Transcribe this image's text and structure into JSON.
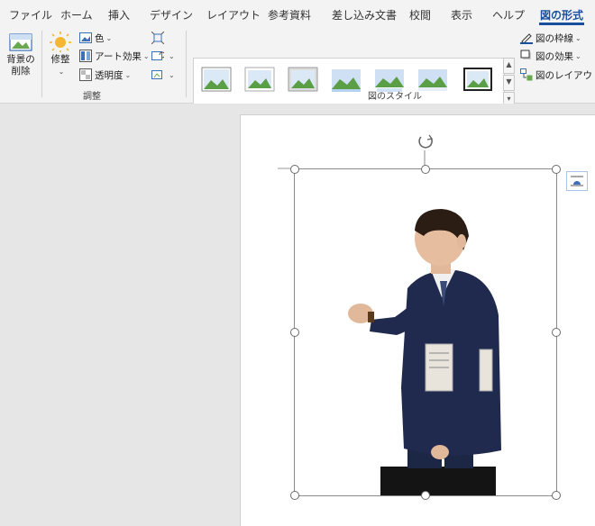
{
  "tabs": [
    {
      "label": "ファイル"
    },
    {
      "label": "ホーム"
    },
    {
      "label": "挿入"
    },
    {
      "label": "デザイン"
    },
    {
      "label": "レイアウト"
    },
    {
      "label": "参考資料"
    },
    {
      "label": "差し込み文書"
    },
    {
      "label": "校閲"
    },
    {
      "label": "表示"
    },
    {
      "label": "ヘルプ"
    },
    {
      "label": "図の形式"
    }
  ],
  "ribbon": {
    "remove_bg_label_1": "背景の",
    "remove_bg_label_2": "削除",
    "corrections_label": "修整",
    "color_label": "色",
    "artistic_label": "アート効果",
    "transparency_label": "透明度",
    "adjust_group": "調整",
    "styles_group": "図のスタイル",
    "border_label": "図の枠線",
    "effects_label": "図の効果",
    "layout_label": "図のレイアウト"
  },
  "colors": {
    "accent": "#1a4f9c",
    "ribbon_bg": "#f3f3f3",
    "doc_bg": "#e6e6e6",
    "suit": "#1f2a4e"
  }
}
